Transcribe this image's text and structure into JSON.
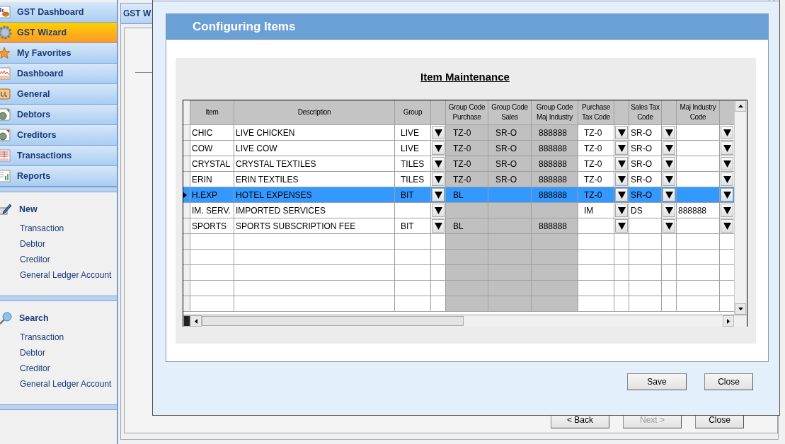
{
  "sidebar": {
    "nav_items": [
      {
        "label": "GST Dashboard",
        "selected": false
      },
      {
        "label": "GST Wizard",
        "selected": true
      },
      {
        "label": "My Favorites",
        "selected": false
      },
      {
        "label": "Dashboard",
        "selected": false
      },
      {
        "label": "General",
        "selected": false
      },
      {
        "label": "Debtors",
        "selected": false
      },
      {
        "label": "Creditors",
        "selected": false
      },
      {
        "label": "Transactions",
        "selected": false
      },
      {
        "label": "Reports",
        "selected": false
      }
    ],
    "sections": [
      {
        "title": "New",
        "links": [
          "Transaction",
          "Debtor",
          "Creditor",
          "General Ledger Account"
        ]
      },
      {
        "title": "Search",
        "links": [
          "Transaction",
          "Debtor",
          "Creditor",
          "General Ledger Account"
        ]
      }
    ]
  },
  "background_window": {
    "tab_title": "GST W",
    "buttons": [
      {
        "label": "< Back",
        "disabled": false
      },
      {
        "label": "Next >",
        "disabled": true
      },
      {
        "label": "Close",
        "disabled": false
      }
    ]
  },
  "dialog": {
    "header": "Configuring Items",
    "title": "Item Maintenance",
    "grid": {
      "columns": [
        {
          "label": "Item",
          "dropdown": false,
          "readonly": false
        },
        {
          "label": "Description",
          "dropdown": false,
          "readonly": false
        },
        {
          "label": "Group",
          "dropdown": true,
          "readonly": false
        },
        {
          "label": "Group Code Purchase",
          "dropdown": false,
          "readonly": true
        },
        {
          "label": "Group Code Sales",
          "dropdown": false,
          "readonly": true
        },
        {
          "label": "Group Code Maj Industry",
          "dropdown": false,
          "readonly": true
        },
        {
          "label": "Purchase Tax Code",
          "dropdown": true,
          "readonly": false
        },
        {
          "label": "Sales Tax Code",
          "dropdown": true,
          "readonly": false
        },
        {
          "label": "Maj Industry Code",
          "dropdown": true,
          "readonly": false
        }
      ],
      "rows": [
        {
          "item": "CHIC",
          "description": "LIVE CHICKEN",
          "group": "LIVE",
          "group_code_purchase": "TZ-0",
          "group_code_sales": "SR-O",
          "group_code_maj_industry": "888888",
          "purchase_tax_code": "TZ-0",
          "sales_tax_code": "SR-O",
          "selected": false
        },
        {
          "item": "COW",
          "description": "LIVE COW",
          "group": "LIVE",
          "group_code_purchase": "TZ-0",
          "group_code_sales": "SR-O",
          "group_code_maj_industry": "888888",
          "purchase_tax_code": "TZ-0",
          "sales_tax_code": "SR-O",
          "selected": false
        },
        {
          "item": "CRYSTAL",
          "description": "CRYSTAL TEXTILES",
          "group": "TILES",
          "group_code_purchase": "TZ-0",
          "group_code_sales": "SR-O",
          "group_code_maj_industry": "888888",
          "purchase_tax_code": "TZ-0",
          "sales_tax_code": "SR-O",
          "selected": false
        },
        {
          "item": "ERIN",
          "description": "ERIN TEXTILES",
          "group": "TILES",
          "group_code_purchase": "TZ-0",
          "group_code_sales": "SR-O",
          "group_code_maj_industry": "888888",
          "purchase_tax_code": "TZ-0",
          "sales_tax_code": "SR-O",
          "selected": false
        },
        {
          "item": "H.EXP",
          "description": "HOTEL EXPENSES",
          "group": "BIT",
          "group_code_purchase": "BL",
          "group_code_maj_industry": "888888",
          "purchase_tax_code": "TZ-0",
          "sales_tax_code": "SR-O",
          "selected": true
        },
        {
          "item": "IM. SERV.",
          "description": "IMPORTED SERVICES",
          "purchase_tax_code": "IM",
          "sales_tax_code": "DS",
          "maj_industry_code": "888888",
          "selected": false
        },
        {
          "item": "SPORTS",
          "description": "SPORTS SUBSCRIPTION FEE",
          "group": "BIT",
          "group_code_purchase": "BL",
          "group_code_maj_industry": "888888",
          "selected": false
        }
      ]
    },
    "buttons": [
      "Save",
      "Close"
    ]
  }
}
